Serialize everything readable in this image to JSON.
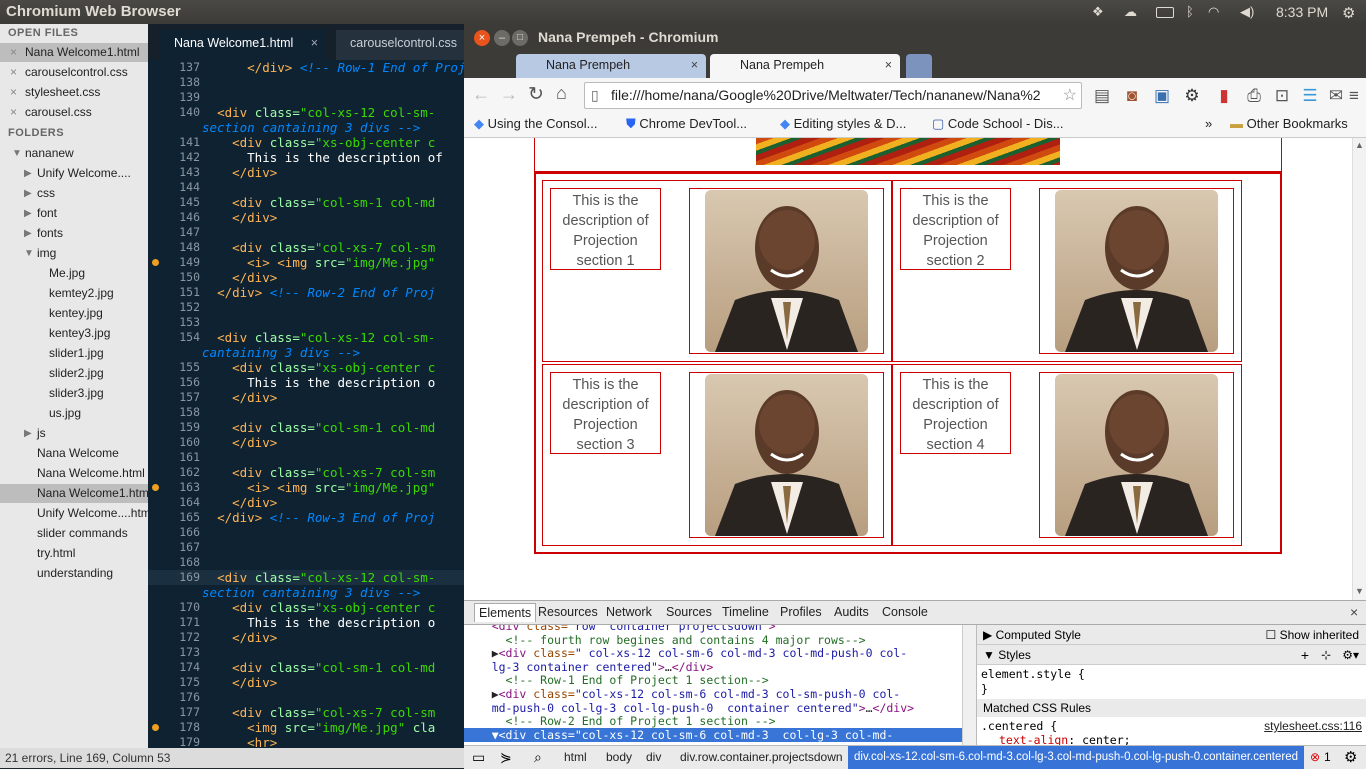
{
  "top_panel": {
    "title": "Chromium Web Browser",
    "time": "8:33 PM",
    "icons": [
      "dropbox-icon",
      "cloud-icon",
      "battery-icon",
      "bluetooth-icon",
      "wifi-icon",
      "volume-icon",
      "settings-gear-icon"
    ]
  },
  "sidebar": {
    "open_files_header": "OPEN FILES",
    "open_files": [
      "Nana Welcome1.html",
      "carouselcontrol.css",
      "stylesheet.css",
      "carousel.css"
    ],
    "folders_header": "FOLDERS",
    "tree": [
      {
        "label": "nananew",
        "type": "folder-open",
        "indent": 0
      },
      {
        "label": "Unify    Welcome....",
        "type": "folder",
        "indent": 1
      },
      {
        "label": "css",
        "type": "folder",
        "indent": 1
      },
      {
        "label": "font",
        "type": "folder",
        "indent": 1
      },
      {
        "label": "fonts",
        "type": "folder",
        "indent": 1
      },
      {
        "label": "img",
        "type": "folder-open",
        "indent": 1
      },
      {
        "label": "Me.jpg",
        "type": "file",
        "indent": 2
      },
      {
        "label": "kemtey2.jpg",
        "type": "file",
        "indent": 2
      },
      {
        "label": "kentey.jpg",
        "type": "file",
        "indent": 2
      },
      {
        "label": "kentey3.jpg",
        "type": "file",
        "indent": 2
      },
      {
        "label": "slider1.jpg",
        "type": "file",
        "indent": 2
      },
      {
        "label": "slider2.jpg",
        "type": "file",
        "indent": 2
      },
      {
        "label": "slider3.jpg",
        "type": "file",
        "indent": 2
      },
      {
        "label": "us.jpg",
        "type": "file",
        "indent": 2
      },
      {
        "label": "js",
        "type": "folder",
        "indent": 1
      },
      {
        "label": "Nana Welcome",
        "type": "file",
        "indent": 1
      },
      {
        "label": "Nana Welcome.html",
        "type": "file",
        "indent": 1
      },
      {
        "label": "Nana Welcome1.html",
        "type": "file",
        "indent": 1,
        "selected": true
      },
      {
        "label": "Unify    Welcome....html",
        "type": "file",
        "indent": 1
      },
      {
        "label": "slider commands",
        "type": "file",
        "indent": 1
      },
      {
        "label": "try.html",
        "type": "file",
        "indent": 1
      },
      {
        "label": "understanding",
        "type": "file",
        "indent": 1
      }
    ]
  },
  "editor": {
    "tabs": [
      "Nana Welcome1.html",
      "carouselcontrol.css"
    ],
    "status": "21 errors, Line 169, Column 53",
    "lines": [
      {
        "n": "137",
        "html": "      <span class='tg'>&lt;/div&gt;</span> <span class='cm'>&lt;!-- Row-1 End of Proje</span>"
      },
      {
        "n": "138",
        "html": ""
      },
      {
        "n": "139",
        "html": ""
      },
      {
        "n": "140",
        "html": "  <span class='tg'>&lt;div</span> <span class='at'>class=</span><span class='st'>\"col-xs-12 col-sm-</span>"
      },
      {
        "n": "",
        "html": "<span class='cm'>section cantaining 3 divs --&gt;</span>"
      },
      {
        "n": "141",
        "html": "    <span class='tg'>&lt;div</span> <span class='at'>class=</span><span class='st'>\"xs-obj-center c</span>"
      },
      {
        "n": "142",
        "html": "      <span class='tx'>This is the description of</span>"
      },
      {
        "n": "143",
        "html": "    <span class='tg'>&lt;/div&gt;</span>"
      },
      {
        "n": "144",
        "html": ""
      },
      {
        "n": "145",
        "html": "    <span class='tg'>&lt;div</span> <span class='at'>class=</span><span class='st'>\"col-sm-1 col-md</span>"
      },
      {
        "n": "146",
        "html": "    <span class='tg'>&lt;/div&gt;</span>"
      },
      {
        "n": "147",
        "html": ""
      },
      {
        "n": "148",
        "html": "    <span class='tg'>&lt;div</span> <span class='at'>class=</span><span class='st'>\"col-xs-7 col-sm</span>"
      },
      {
        "n": "149",
        "html": "      <span class='tg'>&lt;i&gt;</span> <span class='tg'>&lt;img</span> <span class='at'>src=</span><span class='st'>\"img/Me.jpg\"</span>",
        "dot": true
      },
      {
        "n": "150",
        "html": "    <span class='tg'>&lt;/div&gt;</span>"
      },
      {
        "n": "151",
        "html": "  <span class='tg'>&lt;/div&gt;</span> <span class='cm'>&lt;!-- Row-2 End of Proj</span>"
      },
      {
        "n": "152",
        "html": ""
      },
      {
        "n": "153",
        "html": ""
      },
      {
        "n": "154",
        "html": "  <span class='tg'>&lt;div</span> <span class='at'>class=</span><span class='st'>\"col-xs-12 col-sm-</span>"
      },
      {
        "n": "",
        "html": "<span class='cm'>cantaining 3 divs --&gt;</span>"
      },
      {
        "n": "155",
        "html": "    <span class='tg'>&lt;div</span> <span class='at'>class=</span><span class='st'>\"xs-obj-center c</span>"
      },
      {
        "n": "156",
        "html": "      <span class='tx'>This is the description o</span>"
      },
      {
        "n": "157",
        "html": "    <span class='tg'>&lt;/div&gt;</span>"
      },
      {
        "n": "158",
        "html": ""
      },
      {
        "n": "159",
        "html": "    <span class='tg'>&lt;div</span> <span class='at'>class=</span><span class='st'>\"col-sm-1 col-md</span>"
      },
      {
        "n": "160",
        "html": "    <span class='tg'>&lt;/div&gt;</span>"
      },
      {
        "n": "161",
        "html": ""
      },
      {
        "n": "162",
        "html": "    <span class='tg'>&lt;div</span> <span class='at'>class=</span><span class='st'>\"col-xs-7 col-sm</span>"
      },
      {
        "n": "163",
        "html": "      <span class='tg'>&lt;i&gt;</span> <span class='tg'>&lt;img</span> <span class='at'>src=</span><span class='st'>\"img/Me.jpg\"</span>",
        "dot": true
      },
      {
        "n": "164",
        "html": "    <span class='tg'>&lt;/div&gt;</span>"
      },
      {
        "n": "165",
        "html": "  <span class='tg'>&lt;/div&gt;</span> <span class='cm'>&lt;!-- Row-3 End of Proj</span>"
      },
      {
        "n": "166",
        "html": ""
      },
      {
        "n": "167",
        "html": ""
      },
      {
        "n": "168",
        "html": ""
      },
      {
        "n": "169",
        "html": "  <span class='tg'>&lt;div</span> <span class='at'>class=</span><span class='st'>\"col-xs-12 col-sm-</span>"
      },
      {
        "n": "",
        "html": "<span class='cm'>section cantaining 3 divs --&gt;</span>"
      },
      {
        "n": "170",
        "html": "    <span class='tg'>&lt;div</span> <span class='at'>class=</span><span class='st'>\"xs-obj-center c</span>"
      },
      {
        "n": "171",
        "html": "      <span class='tx'>This is the description o</span>"
      },
      {
        "n": "172",
        "html": "    <span class='tg'>&lt;/div&gt;</span>"
      },
      {
        "n": "173",
        "html": ""
      },
      {
        "n": "174",
        "html": "    <span class='tg'>&lt;div</span> <span class='at'>class=</span><span class='st'>\"col-sm-1 col-md</span>"
      },
      {
        "n": "175",
        "html": "    <span class='tg'>&lt;/div&gt;</span>"
      },
      {
        "n": "176",
        "html": ""
      },
      {
        "n": "177",
        "html": "    <span class='tg'>&lt;div</span> <span class='at'>class=</span><span class='st'>\"col-xs-7 col-sm</span>"
      },
      {
        "n": "178",
        "html": "      <span class='tg'>&lt;img</span> <span class='at'>src=</span><span class='st'>\"img/Me.jpg\"</span> <span class='at'>cla</span>",
        "dot": true
      },
      {
        "n": "179",
        "html": "      <span class='tg'>&lt;hr&gt;</span>"
      }
    ]
  },
  "chrome": {
    "window_title": "Nana Prempeh - Chromium",
    "tabs": [
      "Nana Prempeh",
      "Nana Prempeh"
    ],
    "url": "file:///home/nana/Google%20Drive/Meltwater/Tech/nananew/Nana%2",
    "bookmarks": [
      "Using the Consol...",
      "Chrome DevTool...",
      "Editing styles & D...",
      "Code School - Dis..."
    ],
    "bookmarks_more": "»",
    "other_bookmarks": "Other Bookmarks",
    "projects": [
      "This is the description of Projection section 1",
      "This is the description of Projection section 2",
      "This is the description of Projection section 3",
      "This is the description of Projection section 4"
    ]
  },
  "devtools": {
    "tabs": [
      "Elements",
      "Resources",
      "Network",
      "Sources",
      "Timeline",
      "Profiles",
      "Audits",
      "Console"
    ],
    "dom_lines": [
      "    <span class='dtag'>&lt;div</span> <span class='dattr'>class=</span><span class='dval'>\"row  container projectsdown\"</span><span class='dtag'>&gt;</span>",
      "      <span class='dcom'>&lt;!-- fourth row begines and contains 4 major rows--&gt;</span>",
      "    ▶<span class='dtag'>&lt;div</span> <span class='dattr'>class=</span><span class='dval'>\" col-xs-12 col-sm-6 col-md-3 col-md-push-0 col-</span>",
      "    <span class='dval'>lg-3 container centered\"</span><span class='dtag'>&gt;</span>…<span class='dtag'>&lt;/div&gt;</span>",
      "      <span class='dcom'>&lt;!-- Row-1 End of Project 1 section--&gt;</span>",
      "    ▶<span class='dtag'>&lt;div</span> <span class='dattr'>class=</span><span class='dval'>\"col-xs-12 col-sm-6 col-md-3 col-sm-push-0 col-</span>",
      "    <span class='dval'>md-push-0 col-lg-3 col-lg-push-0  container centered\"</span><span class='dtag'>&gt;</span>…<span class='dtag'>&lt;/div&gt;</span>",
      "      <span class='dcom'>&lt;!-- Row-2 End of Project 1 section --&gt;</span>",
      "    ▼<span class='dtag'>&lt;div</span> <span class='dattr'>class=</span><span class='dval'>\"col-xs-12 col-sm-6 col-md-3  col-lg-3 col-md-</span>"
    ],
    "styles": {
      "computed_style": "Computed Style",
      "show_inherited": "Show inherited",
      "styles_header": "Styles",
      "element_style": "element.style {",
      "element_style_close": "}",
      "matched_rules": "Matched CSS Rules",
      "rule_selector": ".centered {",
      "rule_source": "stylesheet.css:116",
      "rule_prop": "text-align",
      "rule_value": "center;"
    },
    "breadcrumbs": [
      "html",
      "body",
      "div",
      "div.row.container.projectsdown",
      "div.col-xs-12.col-sm-6.col-md-3.col-lg-3.col-md-push-0.col-lg-push-0.container.centered"
    ],
    "error_count": "1"
  },
  "colors": {
    "accent_red": "#cc0000",
    "editor_bg": "#0f2232",
    "selected_crumb": "#3874d8"
  }
}
